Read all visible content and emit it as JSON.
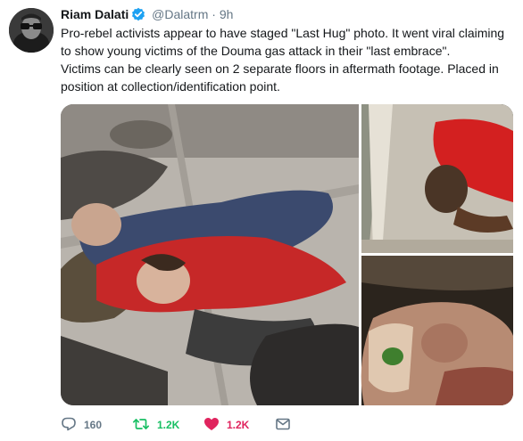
{
  "tweet": {
    "author_name": "Riam Dalati",
    "handle": "@Dalatrm",
    "separator": "·",
    "time": "9h",
    "text_lines": [
      "Pro-rebel activists appear to have staged \"Last Hug\" photo. It went viral claiming to show young victims of the Douma gas attack in their \"last embrace\".",
      "Victims can be clearly seen on 2 separate floors in aftermath footage. Placed in position at collection/identification point."
    ]
  },
  "actions": {
    "reply_count": "160",
    "retweet_count": "1.2K",
    "like_count": "1.2K"
  },
  "colors": {
    "text": "#14171a",
    "secondary": "#657786",
    "verified": "#1da1f2",
    "retweet": "#17bf63",
    "like": "#e0245e"
  },
  "icons": [
    "verified-badge-icon",
    "reply-icon",
    "retweet-icon",
    "heart-icon",
    "direct-message-icon"
  ]
}
